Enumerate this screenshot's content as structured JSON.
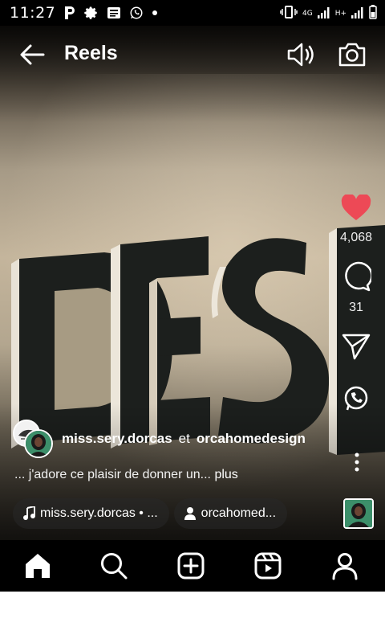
{
  "status_bar": {
    "time": "11:27",
    "network_4g": "4G",
    "network_h": "H+"
  },
  "header": {
    "title": "Reels",
    "back_icon": "arrow-left-icon",
    "sound_icon": "speaker-icon",
    "camera_icon": "camera-icon"
  },
  "actions": {
    "like_count": "4,068",
    "comment_count": "31"
  },
  "post": {
    "author": "miss.sery.dorcas",
    "joiner": "et",
    "collaborator": "orcahomedesign",
    "caption": "... j'adore ce plaisir de donner un...",
    "more_label": "plus"
  },
  "chips": {
    "audio_label": "miss.sery.dorcas • ...",
    "tag_label": "orcahomed..."
  },
  "nav": {
    "items": [
      "home-icon",
      "search-icon",
      "create-icon",
      "reels-icon",
      "profile-icon"
    ]
  },
  "colors": {
    "like_red": "#ed4956",
    "bar_bg": "#000000"
  }
}
